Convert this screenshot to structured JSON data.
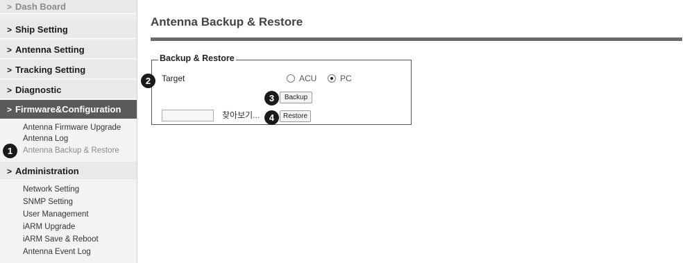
{
  "sidebar": {
    "menus": [
      {
        "label": "Dash Board"
      },
      {
        "label": "Ship Setting"
      },
      {
        "label": "Antenna Setting"
      },
      {
        "label": "Tracking Setting"
      },
      {
        "label": "Diagnostic"
      },
      {
        "label": "Firmware&Configuration"
      },
      {
        "label": "Administration"
      }
    ],
    "firmware_items": [
      {
        "label": "Antenna Firmware Upgrade"
      },
      {
        "label": "Antenna Log"
      },
      {
        "label": "Antenna Backup & Restore"
      }
    ],
    "admin_items": [
      {
        "label": "Network Setting"
      },
      {
        "label": "SNMP Setting"
      },
      {
        "label": "User Management"
      },
      {
        "label": "iARM Upgrade"
      },
      {
        "label": "iARM Save & Reboot"
      },
      {
        "label": "Antenna Event Log"
      }
    ],
    "chevron": ">"
  },
  "main": {
    "title": "Antenna Backup & Restore",
    "section_title": "Backup & Restore",
    "target_label": "Target",
    "radio_options": [
      {
        "label": "ACU",
        "checked": false
      },
      {
        "label": "PC",
        "checked": true
      }
    ],
    "backup_button": "Backup",
    "browse_label": "찾아보기...",
    "restore_button": "Restore",
    "file_value": ""
  },
  "badges": [
    "1",
    "2",
    "3",
    "4"
  ]
}
